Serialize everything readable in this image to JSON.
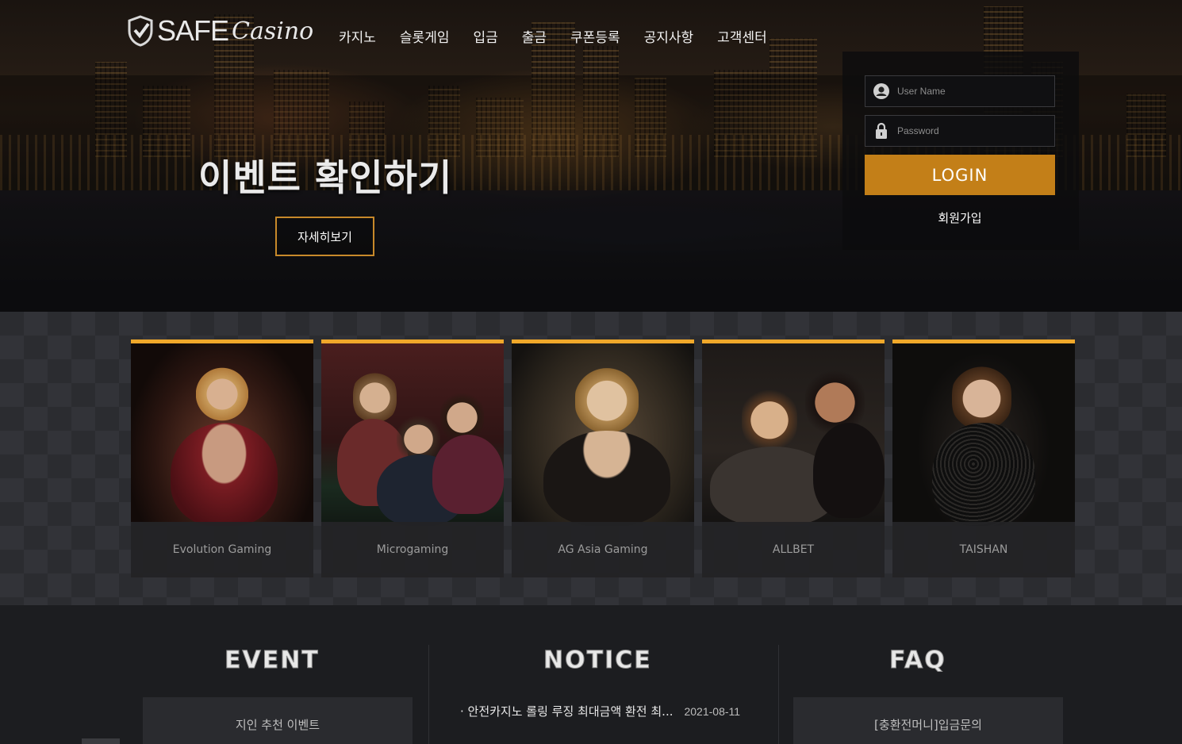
{
  "brand": {
    "name_a": "SAFE",
    "name_b": "Casino"
  },
  "nav": {
    "items": [
      "카지노",
      "슬롯게임",
      "입금",
      "출금",
      "쿠폰등록",
      "공지사항",
      "고객센터"
    ]
  },
  "hero": {
    "title": "이벤트 확인하기",
    "detail_button": "자세히보기"
  },
  "login": {
    "username_placeholder": "User Name",
    "password_placeholder": "Password",
    "login_button": "LOGIN",
    "signup_link": "회원가입"
  },
  "games": [
    {
      "brand": "Evolution Gaming"
    },
    {
      "brand": "Microgaming"
    },
    {
      "brand": "AG Asia Gaming"
    },
    {
      "brand": "ALLBET"
    },
    {
      "brand": "TAISHAN"
    }
  ],
  "sections": {
    "event": {
      "title": "EVENT",
      "item": "지인 추천 이벤트"
    },
    "notice": {
      "title": "NOTICE",
      "item": "· 안전카지노 롤링 루징 최대금액 환전 최...",
      "date": "2021-08-11"
    },
    "faq": {
      "title": "FAQ",
      "item": "[충환전머니]입금문의"
    }
  },
  "colors": {
    "accent": "#c37f18",
    "card_top": "#f0a82a",
    "background": "#1c1d20"
  }
}
